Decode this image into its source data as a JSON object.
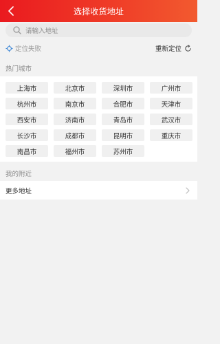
{
  "header": {
    "title": "选择收货地址"
  },
  "search": {
    "placeholder": "请输入地址"
  },
  "location": {
    "status": "定位失败",
    "relocate_label": "重新定位"
  },
  "hot_cities": {
    "label": "热门城市",
    "cities": [
      "上海市",
      "北京市",
      "深圳市",
      "广州市",
      "杭州市",
      "南京市",
      "合肥市",
      "天津市",
      "西安市",
      "济南市",
      "青岛市",
      "武汉市",
      "长沙市",
      "成都市",
      "昆明市",
      "重庆市",
      "南昌市",
      "福州市",
      "苏州市"
    ]
  },
  "nearby": {
    "label": "我的附近",
    "more_label": "更多地址"
  },
  "colors": {
    "accent": "#ea1a1f",
    "accent_end": "#f25a2f",
    "locate_icon": "#4a8fd8"
  }
}
